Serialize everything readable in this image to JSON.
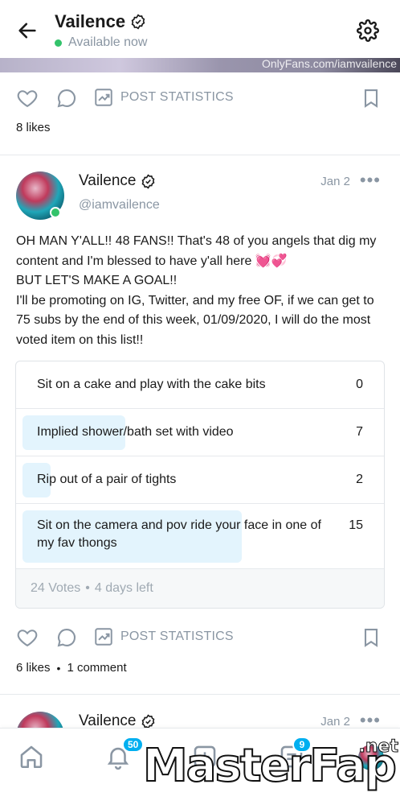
{
  "header": {
    "name": "Vailence",
    "status": "Available now",
    "back_icon": "arrow-left-icon",
    "settings_icon": "gear-icon"
  },
  "media": {
    "watermark": "OnlyFans.com/iamvailence"
  },
  "prev_post": {
    "post_statistics_label": "POST STATISTICS",
    "likes": "8 likes"
  },
  "post": {
    "name": "Vailence",
    "handle": "@iamvailence",
    "date": "Jan 2",
    "more": "•••",
    "text": [
      "OH MAN Y'ALL!! 48 FANS!! That's 48 of you angels that dig my content and I'm blessed to have y'all here 💓💞",
      "BUT LET'S MAKE A GOAL!!",
      "I'll be promoting on IG, Twitter, and my free OF, if we can get to 75 subs by the end of this week, 01/09/2020, I will do the most voted item on this list!!"
    ],
    "poll": {
      "options": [
        {
          "label": "Sit on a cake and play with the cake bits",
          "count": "0",
          "fraction": 0
        },
        {
          "label": "Implied shower/bath set with video",
          "count": "7",
          "fraction": 0.29
        },
        {
          "label": "Rip out of a pair of tights",
          "count": "2",
          "fraction": 0.08
        },
        {
          "label": "Sit on the camera and pov ride your face in one of my fav thongs",
          "count": "15",
          "fraction": 0.62
        }
      ],
      "votes": "24 Votes",
      "time_left": "4 days left"
    },
    "post_statistics_label": "POST STATISTICS",
    "likes": "6 likes",
    "comments": "1 comment"
  },
  "next_post": {
    "name": "Vailence",
    "date": "Jan 2",
    "more": "•••"
  },
  "bottom_nav": {
    "items": [
      {
        "name": "home-icon"
      },
      {
        "name": "bell-icon",
        "badge": "50"
      },
      {
        "name": "plus-square-icon"
      },
      {
        "name": "messages-icon",
        "badge": "9"
      },
      {
        "name": "profile-avatar-icon"
      }
    ]
  },
  "overlay": {
    "brand": "MasterFap",
    "tld": ".net"
  },
  "colors": {
    "accent": "#00aff0",
    "online": "#33c36b",
    "muted": "#8a96a3",
    "poll_fill": "#e3f4fd"
  }
}
